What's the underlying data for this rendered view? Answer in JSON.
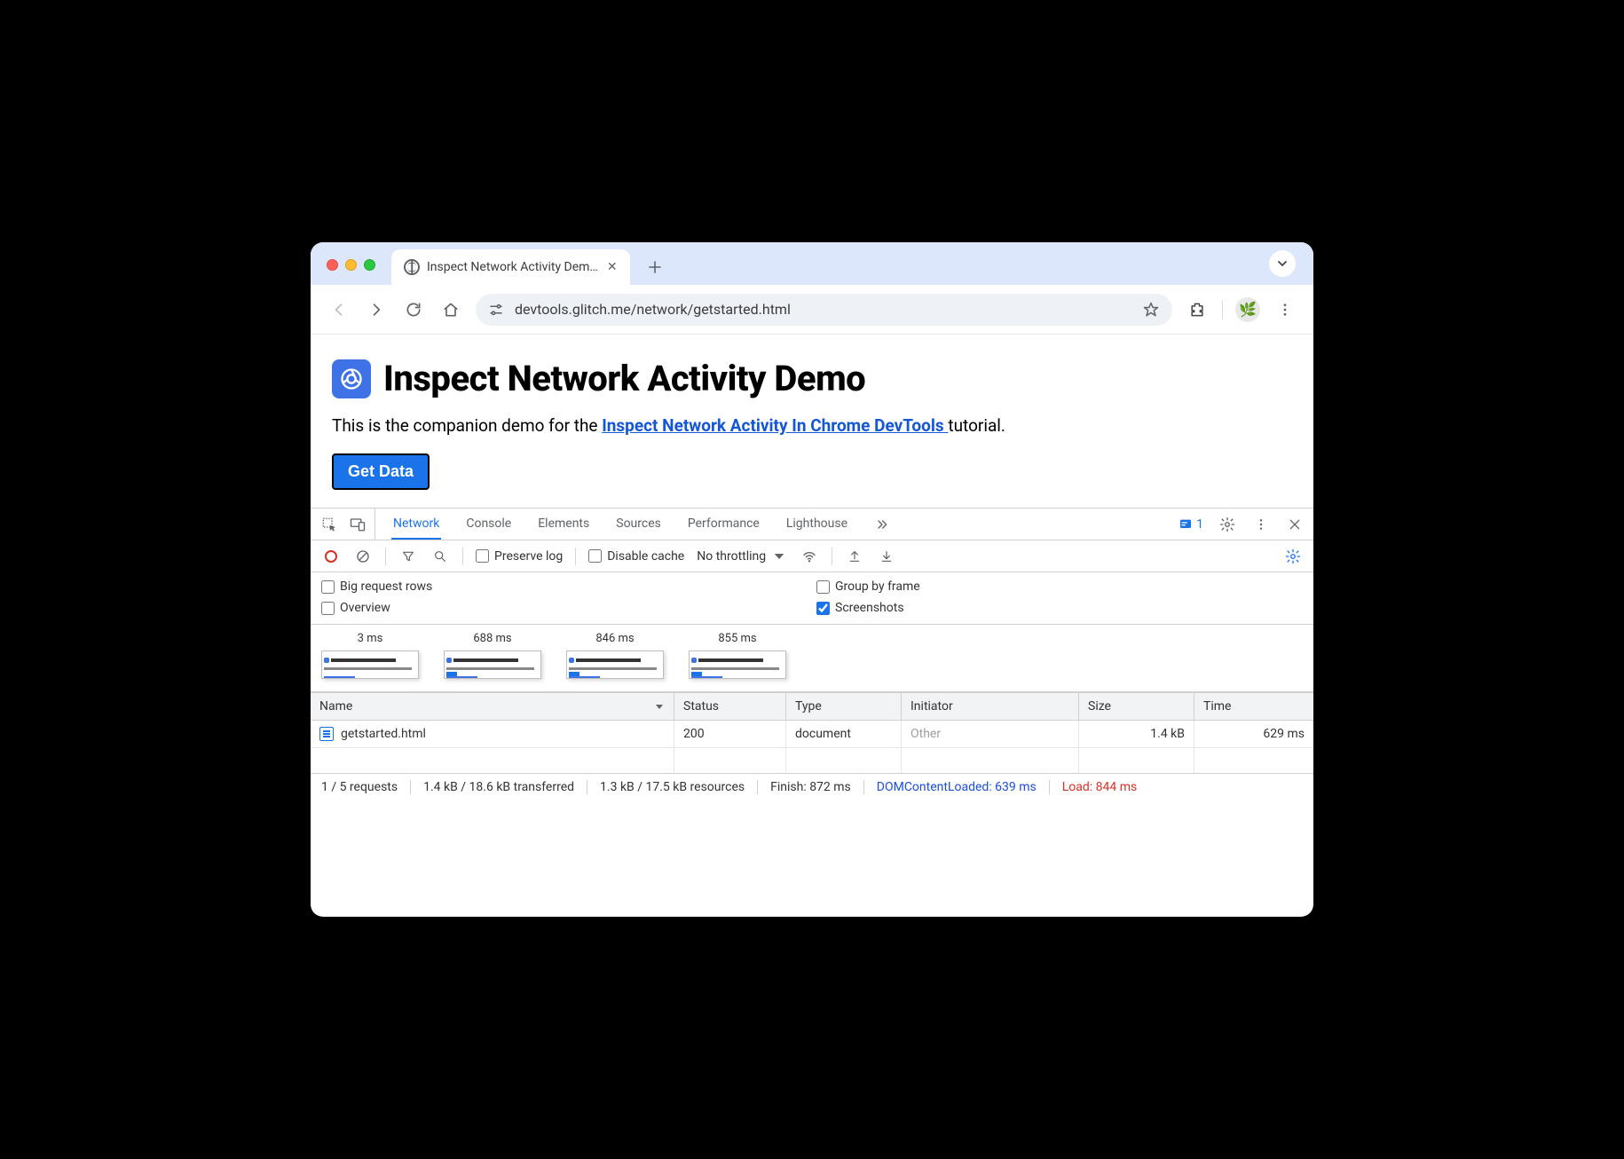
{
  "window": {
    "tab_title": "Inspect Network Activity Dem…"
  },
  "address_bar": {
    "url": "devtools.glitch.me/network/getstarted.html"
  },
  "page": {
    "heading": "Inspect Network Activity Demo",
    "intro_prefix": "This is the companion demo for the ",
    "link_text": "Inspect Network Activity In Chrome DevTools ",
    "intro_suffix": "tutorial.",
    "button_label": "Get Data"
  },
  "devtools": {
    "tabs": [
      "Network",
      "Console",
      "Elements",
      "Sources",
      "Performance",
      "Lighthouse"
    ],
    "issue_count": "1",
    "toolbar": {
      "preserve_log": "Preserve log",
      "disable_cache": "Disable cache",
      "throttling": "No throttling"
    },
    "options": {
      "big_rows": "Big request rows",
      "group_frame": "Group by frame",
      "overview": "Overview",
      "screenshots": "Screenshots"
    },
    "screenshots": [
      "3 ms",
      "688 ms",
      "846 ms",
      "855 ms"
    ],
    "columns": {
      "name": "Name",
      "status": "Status",
      "type": "Type",
      "initiator": "Initiator",
      "size": "Size",
      "time": "Time"
    },
    "rows": [
      {
        "name": "getstarted.html",
        "status": "200",
        "type": "document",
        "initiator": "Other",
        "size": "1.4 kB",
        "time": "629 ms"
      }
    ],
    "status": {
      "requests": "1 / 5 requests",
      "transferred": "1.4 kB / 18.6 kB transferred",
      "resources": "1.3 kB / 17.5 kB resources",
      "finish": "Finish: 872 ms",
      "dcl": "DOMContentLoaded: 639 ms",
      "load": "Load: 844 ms"
    }
  }
}
